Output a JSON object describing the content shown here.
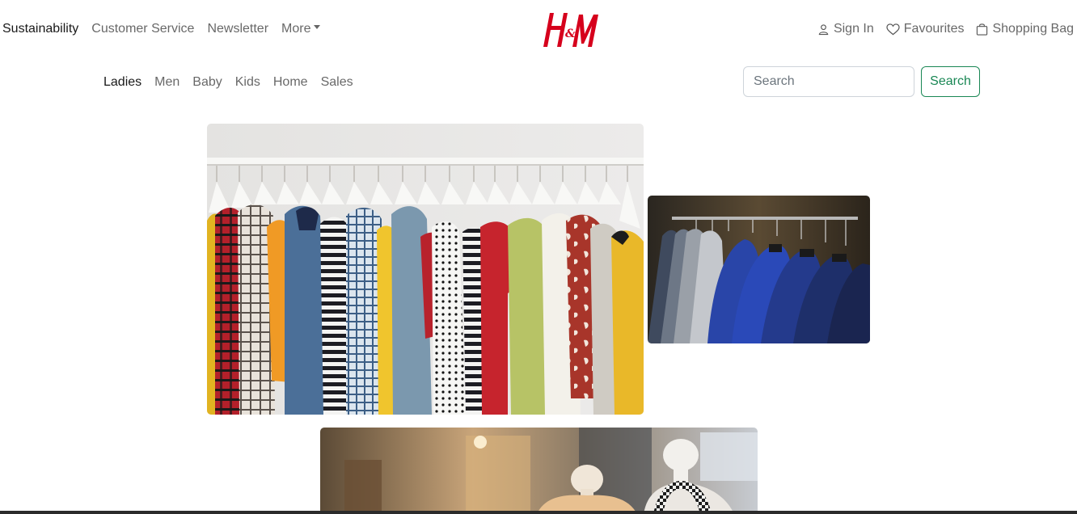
{
  "top_nav": {
    "links": [
      "Sustainability",
      "Customer Service",
      "Newsletter"
    ],
    "more_label": "More"
  },
  "brand": {
    "logo_text": "H&M",
    "color": "#d6001c"
  },
  "utility": {
    "sign_in": "Sign In",
    "favourites": "Favourites",
    "shopping_bag": "Shopping Bag"
  },
  "categories": [
    "Ladies",
    "Men",
    "Baby",
    "Kids",
    "Home",
    "Sales"
  ],
  "search": {
    "placeholder": "Search",
    "button_label": "Search"
  },
  "icons": {
    "sign_in": "person-icon",
    "favourites": "heart-icon",
    "shopping_bag": "bag-icon",
    "more": "caret-down-icon"
  },
  "colors": {
    "accent_green": "#198754",
    "logo_red": "#d6001c"
  },
  "images": [
    {
      "subject": "clothing-rack-colorful-shirts"
    },
    {
      "subject": "suit-jackets-on-rack"
    },
    {
      "subject": "mannequins-in-store"
    }
  ]
}
